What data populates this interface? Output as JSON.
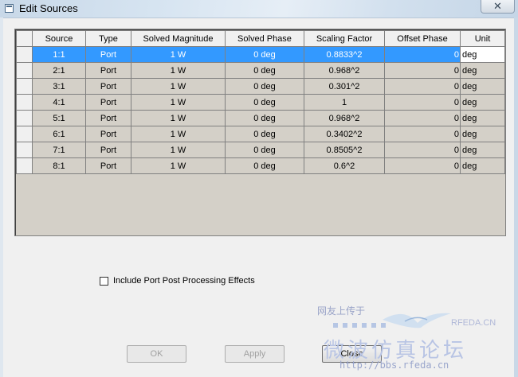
{
  "window": {
    "title": "Edit Sources",
    "close_glyph": "✕"
  },
  "table": {
    "headers": [
      "Source",
      "Type",
      "Solved Magnitude",
      "Solved Phase",
      "Scaling Factor",
      "Offset Phase",
      "Unit"
    ],
    "selected_row": 0,
    "rows": [
      [
        "1:1",
        "Port",
        "1 W",
        "0 deg",
        "0.8833^2",
        "0",
        "deg"
      ],
      [
        "2:1",
        "Port",
        "1 W",
        "0 deg",
        "0.968^2",
        "0",
        "deg"
      ],
      [
        "3:1",
        "Port",
        "1 W",
        "0 deg",
        "0.301^2",
        "0",
        "deg"
      ],
      [
        "4:1",
        "Port",
        "1 W",
        "0 deg",
        "1",
        "0",
        "deg"
      ],
      [
        "5:1",
        "Port",
        "1 W",
        "0 deg",
        "0.968^2",
        "0",
        "deg"
      ],
      [
        "6:1",
        "Port",
        "1 W",
        "0 deg",
        "0.3402^2",
        "0",
        "deg"
      ],
      [
        "7:1",
        "Port",
        "1 W",
        "0 deg",
        "0.8505^2",
        "0",
        "deg"
      ],
      [
        "8:1",
        "Port",
        "1 W",
        "0 deg",
        "0.6^2",
        "0",
        "deg"
      ]
    ]
  },
  "options": {
    "include_port_post_label": "Include Port Post Processing Effects",
    "include_port_post_checked": false
  },
  "buttons": {
    "ok": "OK",
    "apply": "Apply",
    "close": "Close"
  },
  "watermark": {
    "top_text": "网友上传于",
    "brand": "RFEDA.CN",
    "chinese": "微波仿真论坛",
    "url": "http://bbs.rfeda.cn"
  },
  "colors": {
    "selection": "#3399ff",
    "grid_background": "#d4d0c8",
    "header_background": "#f0f0f0"
  }
}
